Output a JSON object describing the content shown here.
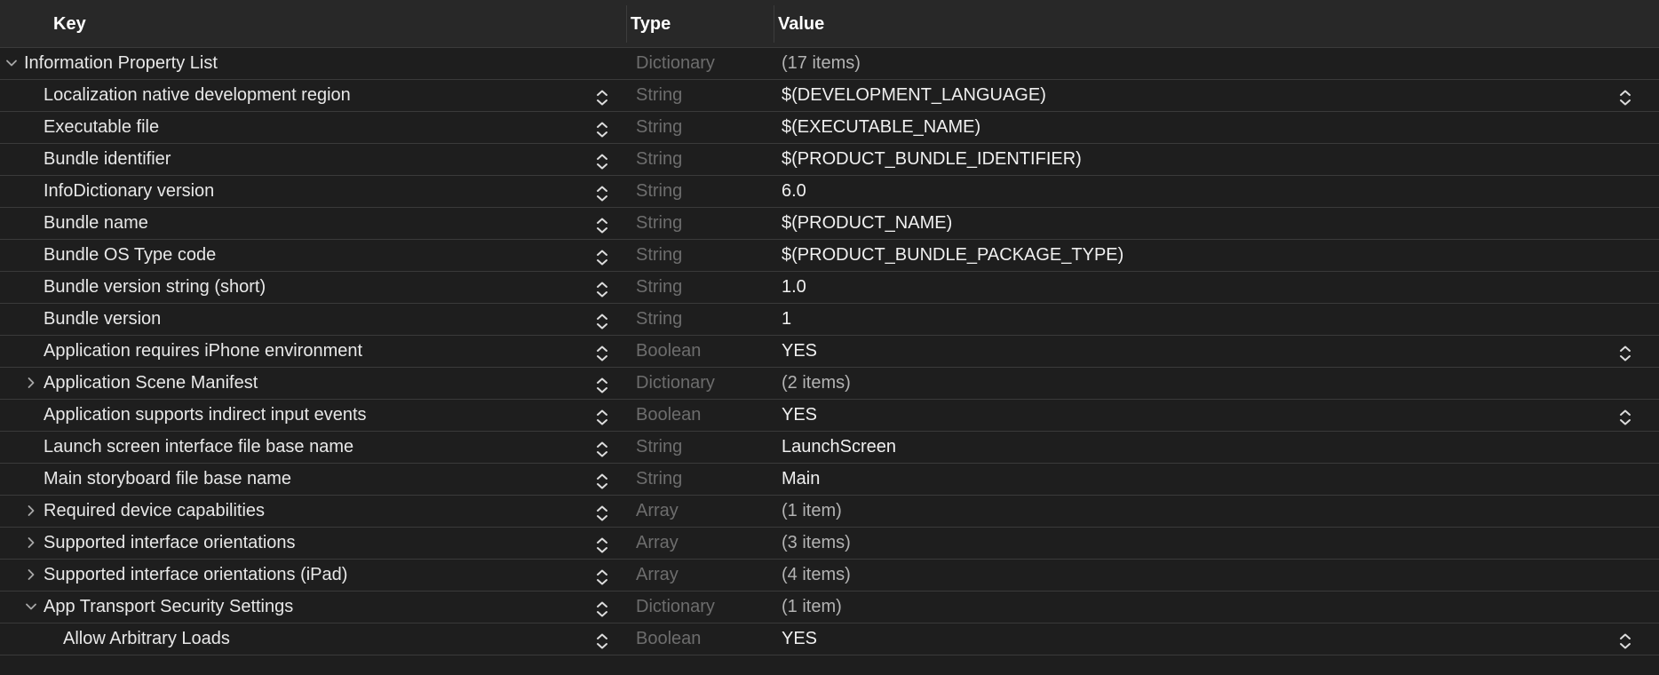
{
  "header": {
    "key_label": "Key",
    "type_label": "Type",
    "value_label": "Value"
  },
  "icons": {
    "disclosure_expanded": "chevron-down-icon",
    "disclosure_collapsed": "chevron-right-icon",
    "type_stepper": "up-down-stepper-icon",
    "value_popup": "up-down-stepper-icon"
  },
  "colors": {
    "background": "#1e1e1e",
    "header_background": "#282828",
    "separator": "#3a3a3a",
    "text": "#e8e8e8",
    "type_text": "#6d6d6d",
    "count_text": "#b3b3b3"
  },
  "rows": [
    {
      "key": "Information Property List",
      "type": "Dictionary",
      "value": "(17 items)",
      "disclosure": "expanded",
      "level": 0,
      "stepper": false,
      "value_popup": false,
      "value_muted": true
    },
    {
      "key": "Localization native development region",
      "type": "String",
      "value": "$(DEVELOPMENT_LANGUAGE)",
      "disclosure": "none",
      "level": 1,
      "stepper": true,
      "value_popup": true,
      "value_muted": false
    },
    {
      "key": "Executable file",
      "type": "String",
      "value": "$(EXECUTABLE_NAME)",
      "disclosure": "none",
      "level": 1,
      "stepper": true,
      "value_popup": false,
      "value_muted": false
    },
    {
      "key": "Bundle identifier",
      "type": "String",
      "value": "$(PRODUCT_BUNDLE_IDENTIFIER)",
      "disclosure": "none",
      "level": 1,
      "stepper": true,
      "value_popup": false,
      "value_muted": false
    },
    {
      "key": "InfoDictionary version",
      "type": "String",
      "value": "6.0",
      "disclosure": "none",
      "level": 1,
      "stepper": true,
      "value_popup": false,
      "value_muted": false
    },
    {
      "key": "Bundle name",
      "type": "String",
      "value": "$(PRODUCT_NAME)",
      "disclosure": "none",
      "level": 1,
      "stepper": true,
      "value_popup": false,
      "value_muted": false
    },
    {
      "key": "Bundle OS Type code",
      "type": "String",
      "value": "$(PRODUCT_BUNDLE_PACKAGE_TYPE)",
      "disclosure": "none",
      "level": 1,
      "stepper": true,
      "value_popup": false,
      "value_muted": false
    },
    {
      "key": "Bundle version string (short)",
      "type": "String",
      "value": "1.0",
      "disclosure": "none",
      "level": 1,
      "stepper": true,
      "value_popup": false,
      "value_muted": false
    },
    {
      "key": "Bundle version",
      "type": "String",
      "value": "1",
      "disclosure": "none",
      "level": 1,
      "stepper": true,
      "value_popup": false,
      "value_muted": false
    },
    {
      "key": "Application requires iPhone environment",
      "type": "Boolean",
      "value": "YES",
      "disclosure": "none",
      "level": 1,
      "stepper": true,
      "value_popup": true,
      "value_muted": false
    },
    {
      "key": "Application Scene Manifest",
      "type": "Dictionary",
      "value": "(2 items)",
      "disclosure": "collapsed",
      "level": 1,
      "stepper": true,
      "value_popup": false,
      "value_muted": true
    },
    {
      "key": "Application supports indirect input events",
      "type": "Boolean",
      "value": "YES",
      "disclosure": "none",
      "level": 1,
      "stepper": true,
      "value_popup": true,
      "value_muted": false
    },
    {
      "key": "Launch screen interface file base name",
      "type": "String",
      "value": "LaunchScreen",
      "disclosure": "none",
      "level": 1,
      "stepper": true,
      "value_popup": false,
      "value_muted": false
    },
    {
      "key": "Main storyboard file base name",
      "type": "String",
      "value": "Main",
      "disclosure": "none",
      "level": 1,
      "stepper": true,
      "value_popup": false,
      "value_muted": false
    },
    {
      "key": "Required device capabilities",
      "type": "Array",
      "value": "(1 item)",
      "disclosure": "collapsed",
      "level": 1,
      "stepper": true,
      "value_popup": false,
      "value_muted": true
    },
    {
      "key": "Supported interface orientations",
      "type": "Array",
      "value": "(3 items)",
      "disclosure": "collapsed",
      "level": 1,
      "stepper": true,
      "value_popup": false,
      "value_muted": true
    },
    {
      "key": "Supported interface orientations (iPad)",
      "type": "Array",
      "value": "(4 items)",
      "disclosure": "collapsed",
      "level": 1,
      "stepper": true,
      "value_popup": false,
      "value_muted": true
    },
    {
      "key": "App Transport Security Settings",
      "type": "Dictionary",
      "value": "(1 item)",
      "disclosure": "expanded",
      "level": 1,
      "stepper": true,
      "value_popup": false,
      "value_muted": true
    },
    {
      "key": "Allow Arbitrary Loads",
      "type": "Boolean",
      "value": "YES",
      "disclosure": "none",
      "level": 2,
      "stepper": true,
      "value_popup": true,
      "value_muted": false
    }
  ]
}
